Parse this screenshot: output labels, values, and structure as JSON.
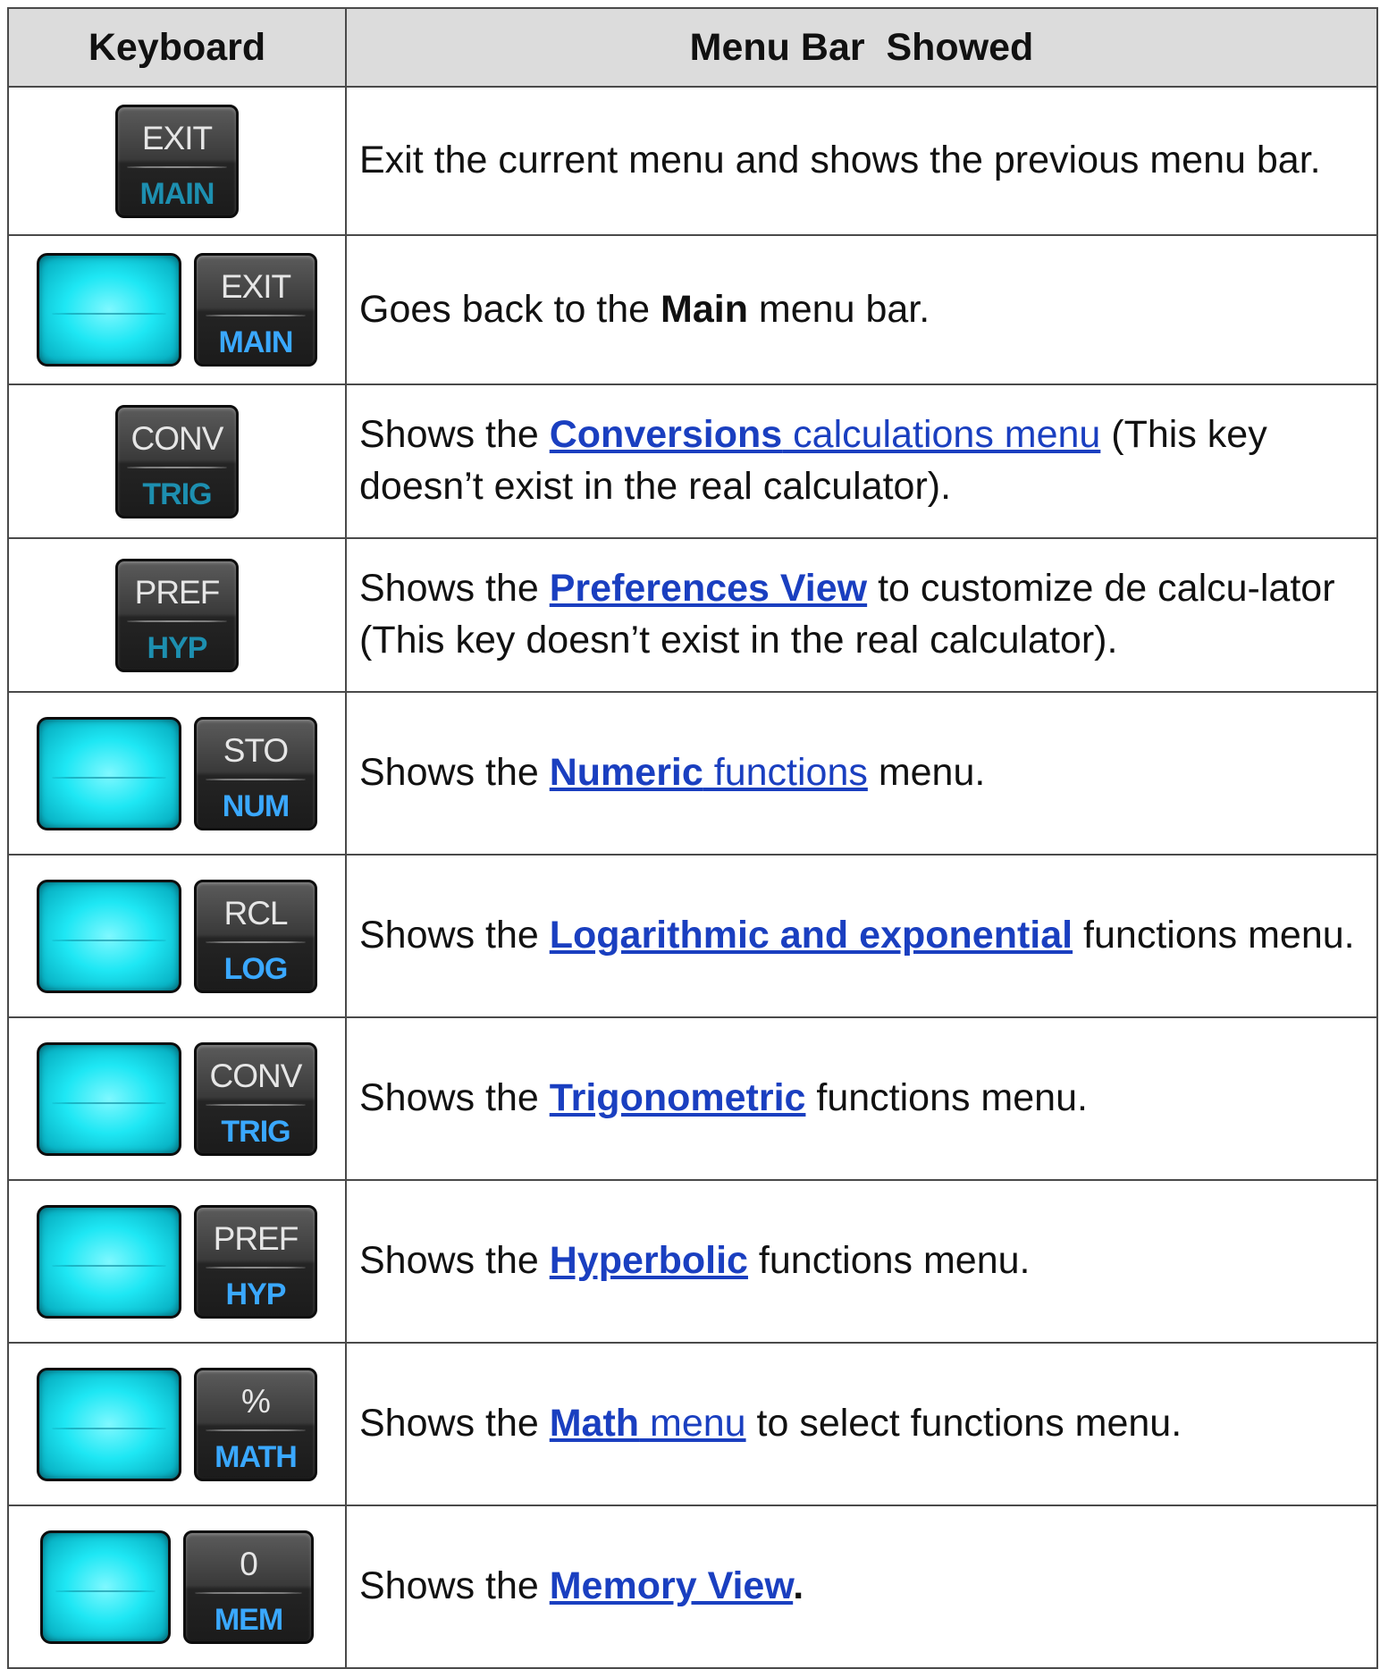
{
  "header": {
    "keyboard": "Keyboard",
    "menu_bar": "Menu Bar  Showed"
  },
  "rows": [
    {
      "key_top": "EXIT",
      "key_bottom": "MAIN",
      "text": "Exit the current menu and shows the previous menu bar."
    },
    {
      "key_top": "EXIT",
      "key_bottom": "MAIN",
      "pre": "Goes back to the ",
      "bold": "Main",
      "post": " menu bar."
    },
    {
      "key_top": "CONV",
      "key_bottom": "TRIG",
      "pre": "Shows the ",
      "link_bold": "Conversions",
      "link_rest": " calculations menu",
      "post": " (This key doesn’t exist in the real calculator)."
    },
    {
      "key_top": "PREF",
      "key_bottom": "HYP",
      "pre": "Shows the ",
      "link_bold": "Preferences View",
      "post": " to customize de calcu-lator (This key doesn’t exist in the real calculator)."
    },
    {
      "key_top": "STO",
      "key_bottom": "NUM",
      "pre": "Shows the ",
      "link_bold": "Numeric",
      "link_rest": " functions",
      "post": " menu."
    },
    {
      "key_top": "RCL",
      "key_bottom": "LOG",
      "pre": "Shows the ",
      "link_bold": "Logarithmic and exponential",
      "post": " functions menu."
    },
    {
      "key_top": "CONV",
      "key_bottom": "TRIG",
      "pre": "Shows the ",
      "link_bold": "Trigonometric",
      "post": " functions menu."
    },
    {
      "key_top": "PREF",
      "key_bottom": "HYP",
      "pre": "Shows the ",
      "link_bold": "Hyperbolic",
      "post": " functions menu."
    },
    {
      "key_top": "%",
      "key_bottom": "MATH",
      "pre": "Shows the ",
      "link_bold": "Math",
      "link_rest": " menu",
      "post": " to select functions menu."
    },
    {
      "key_top": "0",
      "key_bottom": "MEM",
      "pre": "Shows the ",
      "link_bold": "Memory View",
      "post_bold": "."
    }
  ],
  "colors": {
    "link": "#1a3fc0",
    "header_bg": "#dcdcdc",
    "shift_key": "#1ee7f4",
    "key_label_dim": "#1d8fb0",
    "key_label_lit": "#3aa8ff"
  },
  "icons": [
    "shift-key-icon",
    "calculator-key-icon"
  ]
}
